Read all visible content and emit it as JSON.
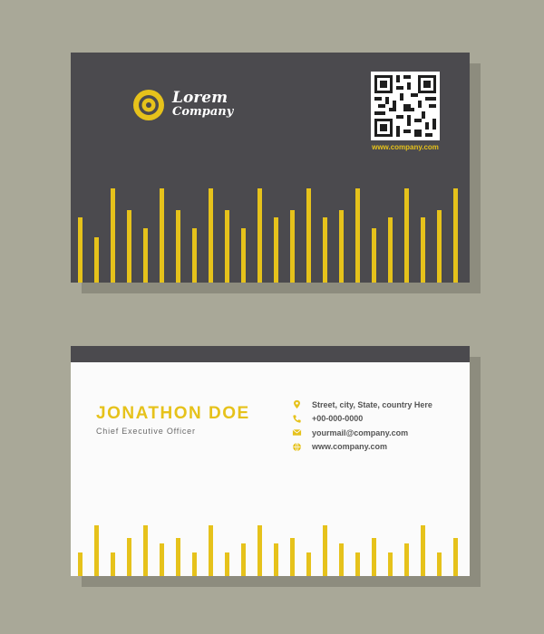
{
  "colors": {
    "background": "#a9a898",
    "card_dark": "#4b4a4e",
    "card_light": "#fbfbfb",
    "accent": "#e6c21b"
  },
  "front": {
    "logo_line1": "Lorem",
    "logo_line2": "Company",
    "website": "www.company.com"
  },
  "back": {
    "name": "JONATHON DOE",
    "title": "Chief Executive Officer",
    "contacts": [
      {
        "icon": "location-pin-icon",
        "text": "Street, city, State, country Here"
      },
      {
        "icon": "phone-icon",
        "text": "+00-000-0000"
      },
      {
        "icon": "envelope-icon",
        "text": "yourmail@company.com"
      },
      {
        "icon": "globe-icon",
        "text": "www.company.com"
      }
    ]
  }
}
